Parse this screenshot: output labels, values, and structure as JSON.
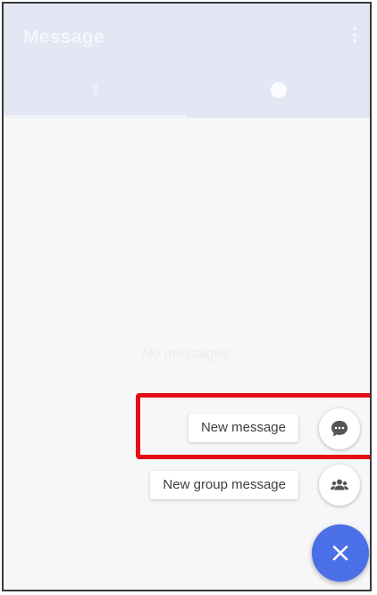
{
  "app_bar": {
    "title": "Message",
    "menu_icon": "more-vertical-icon",
    "background_color": "#e3e6f3"
  },
  "tabs": [
    {
      "icon": "tab-icon-1"
    },
    {
      "icon": "tab-icon-2"
    }
  ],
  "main": {
    "empty_text": "No messages"
  },
  "speed_dial": {
    "items": [
      {
        "label": "New message",
        "icon": "chat-bubble-icon"
      },
      {
        "label": "New group message",
        "icon": "group-icon"
      }
    ],
    "close_icon": "close-icon",
    "fab_color": "#4a6fe6"
  },
  "highlight_color": "#e50c16"
}
